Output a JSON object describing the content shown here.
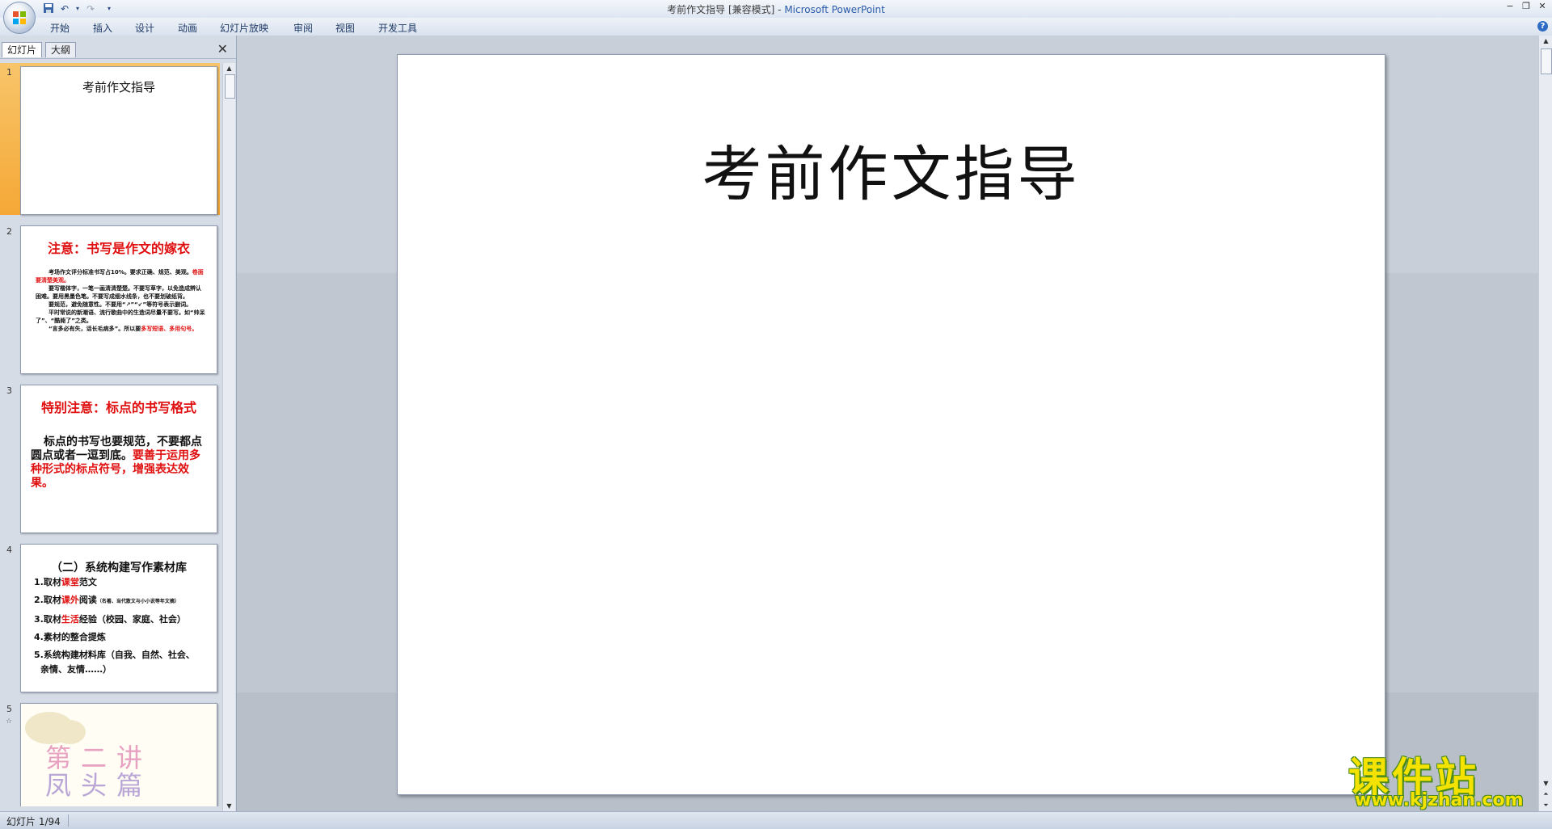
{
  "window": {
    "document_title": "考前作文指导 [兼容模式]",
    "separator": " - ",
    "app_name": "Microsoft PowerPoint",
    "controls": [
      "−",
      "❐",
      "✕"
    ]
  },
  "quick_access": {
    "save_icon": "save-icon",
    "undo_icon": "undo-icon",
    "redo_icon": "redo-icon",
    "customize_icon": "dropdown-icon"
  },
  "ribbon_tabs": [
    "开始",
    "插入",
    "设计",
    "动画",
    "幻灯片放映",
    "审阅",
    "视图",
    "开发工具"
  ],
  "pane": {
    "tab_slides": "幻灯片",
    "tab_outline": "大纲",
    "close": "✕"
  },
  "thumbnails": [
    {
      "num": "1",
      "title": "考前作文指导"
    },
    {
      "num": "2",
      "title": "注意：书写是作文的嫁衣",
      "lines": [
        "考场作文评分标准书写占10%。要求正确、规范、美观。",
        "卷面要清楚美观。",
        "要写楷体字，一笔一画清清楚楚。不要写草字，以免造成辨认困难。要用黑墨色笔。不要写成细水线条，也不要划破纸背。",
        "要规范，避免随意性。不要用“↗”“↙”等符号表示删词。",
        "平时常说的新潮语、流行歌曲中的生造词尽量不要写。如“帅呆了”、“酷毙了”之类。",
        "“言多必有失，话长毛病多”。所以要",
        "多写短语、多用句号。"
      ]
    },
    {
      "num": "3",
      "title": "特别注意：标点的书写格式",
      "body": "标点的书写也要规范，不要都点圆点或者一逗到底。",
      "body_red": "要善于运用多种形式的标点符号，增强表达效果。"
    },
    {
      "num": "4",
      "title": "（二）系统构建写作素材库",
      "items": [
        {
          "a": "1.取材",
          "r": "课堂",
          "b": "范文"
        },
        {
          "a": "2.取材",
          "r": "课外",
          "b": "阅读",
          "tiny": "（名著、当代散文与小小说等年文摘）"
        },
        {
          "a": "3.取材",
          "r": "生活",
          "b": "经验（校园、家庭、社会）"
        },
        {
          "a": "4.素材的整合提炼",
          "r": "",
          "b": ""
        },
        {
          "a": "5.系统构建材料库（自我、自然、社会、",
          "r": "",
          "b": ""
        },
        {
          "a": "亲情、友情……）",
          "r": "",
          "b": ""
        }
      ]
    },
    {
      "num": "5",
      "art_line1": "第二讲",
      "art_line2": "凤头篇"
    }
  ],
  "slide": {
    "title": "考前作文指导"
  },
  "status": {
    "slide_counter": "幻灯片 1/94"
  },
  "watermark": {
    "cn": "课件站",
    "url": "www.kjzhan.com"
  },
  "colors": {
    "accent_red": "#e01010",
    "selection_orange": "#f5a836",
    "ribbon_text": "#1f3a66"
  }
}
